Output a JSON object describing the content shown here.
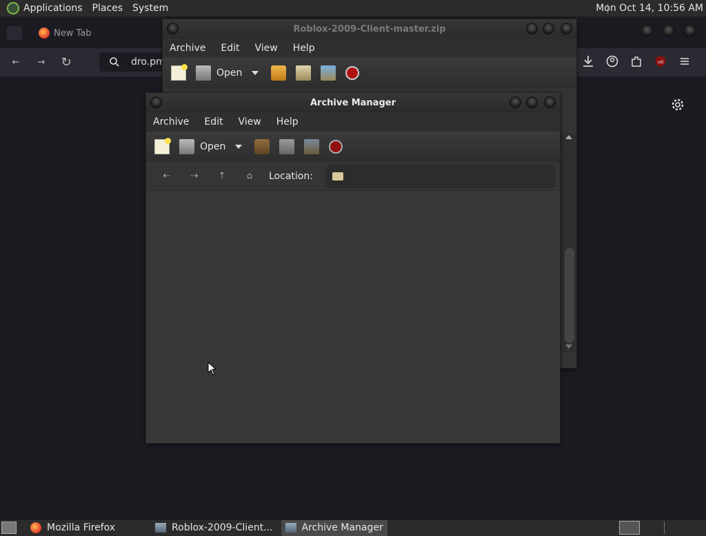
{
  "top_panel": {
    "applications": "Applications",
    "places": "Places",
    "system": "System",
    "clock": "Mon Oct 14, 10:56 AM"
  },
  "firefox": {
    "tab_title": "New Tab",
    "url_text": "dro.pm"
  },
  "back_window": {
    "title": "Roblox-2009-Client-master.zip",
    "menu": [
      "Archive",
      "Edit",
      "View",
      "Help"
    ],
    "open_label": "Open"
  },
  "front_window": {
    "title": "Archive Manager",
    "menu": [
      "Archive",
      "Edit",
      "View",
      "Help"
    ],
    "open_label": "Open",
    "location_label": "Location:"
  },
  "taskbar": {
    "items": [
      "Mozilla Firefox",
      "Roblox-2009-Client...",
      "Archive Manager"
    ]
  },
  "colors": {
    "accent_stop": "#b01010",
    "folder": "#d8c89a"
  }
}
